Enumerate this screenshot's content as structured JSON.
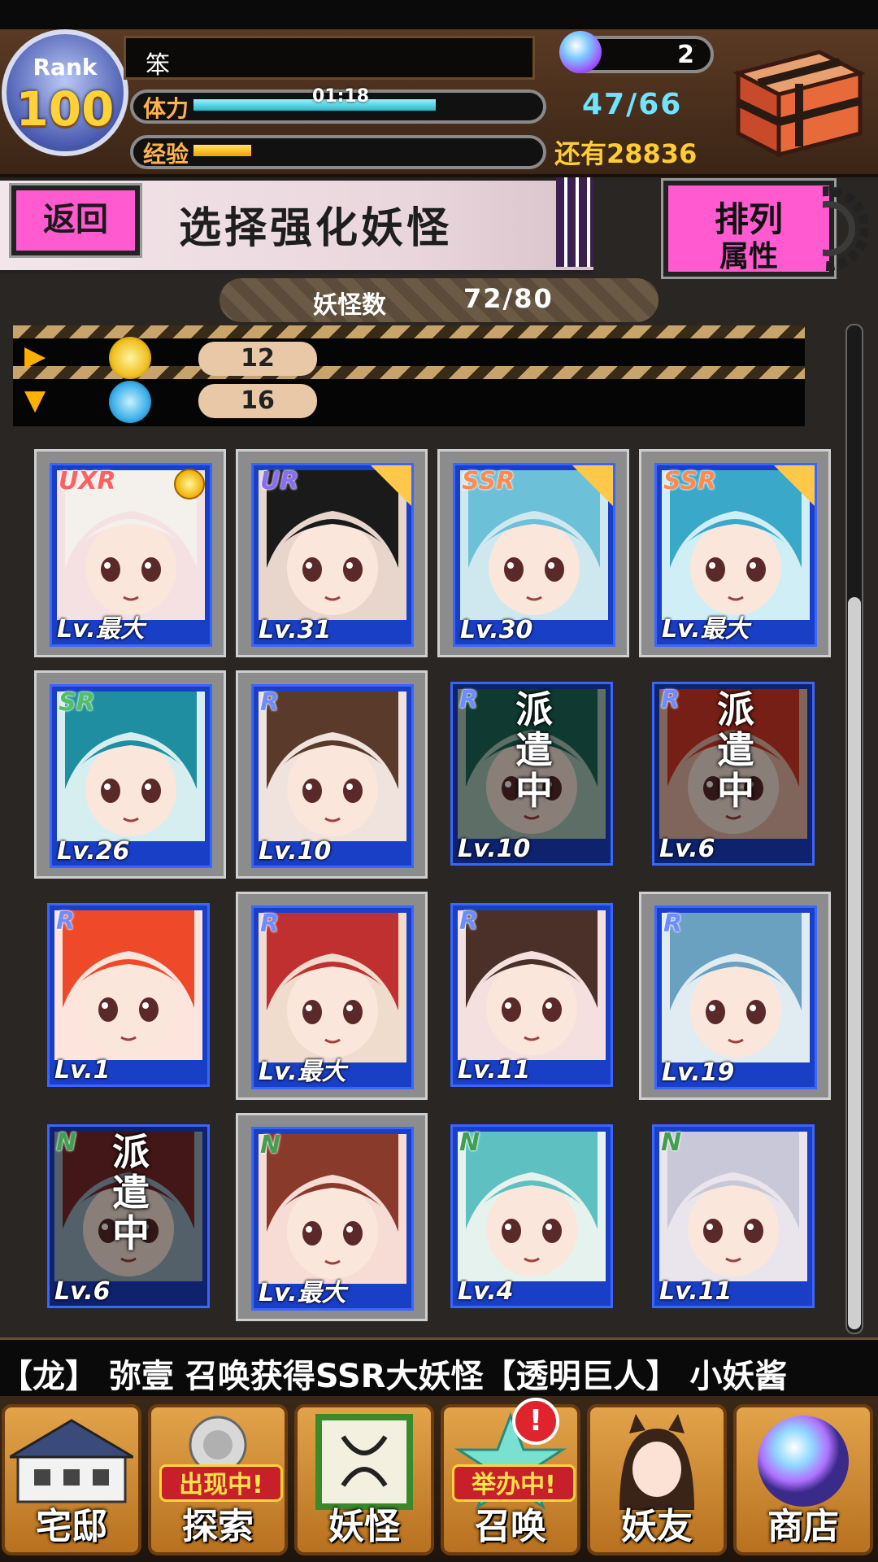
{
  "header": {
    "rank_label": "Rank",
    "rank_value": "100",
    "player_name": "笨",
    "stamina_label": "体力",
    "stamina_timer": "01:18",
    "stamina_value": "47/66",
    "stamina_fill": 0.71,
    "exp_label": "经验",
    "exp_fill": 0.17,
    "remaining_exp": "还有28836",
    "gem_count": "2"
  },
  "title_bar": {
    "back_label": "返回",
    "title": "选择强化妖怪",
    "sort_label": "排列",
    "sort_value": "属性"
  },
  "monster_count": {
    "label": "妖怪数",
    "value": "72/80"
  },
  "filters": [
    {
      "arrow": "▶",
      "icon": "gold-element-icon",
      "color": "#f0c020",
      "count": "12"
    },
    {
      "arrow": "▼",
      "icon": "water-element-icon",
      "color": "#3ab0e8",
      "count": "16"
    }
  ],
  "cards": [
    {
      "rarity": "UXR",
      "level": "Lv.最大",
      "dispatched": false,
      "selected": true,
      "bg": "#f5e1e1",
      "hair": "#f4f0ec",
      "medal": true
    },
    {
      "rarity": "UR",
      "level": "Lv.31",
      "dispatched": false,
      "selected": true,
      "bg": "#e8d6cc",
      "hair": "#1a1a1a",
      "star": true
    },
    {
      "rarity": "SSR",
      "level": "Lv.30",
      "dispatched": false,
      "selected": true,
      "bg": "#cfe8ef",
      "hair": "#6cc0d8",
      "star": true
    },
    {
      "rarity": "SSR",
      "level": "Lv.最大",
      "dispatched": false,
      "selected": true,
      "bg": "#cfeef6",
      "hair": "#3aa8c8",
      "star": true
    },
    {
      "rarity": "SR",
      "level": "Lv.26",
      "dispatched": false,
      "selected": true,
      "bg": "#d6eef0",
      "hair": "#1e8ea0"
    },
    {
      "rarity": "R",
      "level": "Lv.10",
      "dispatched": false,
      "selected": true,
      "bg": "#f0e2dc",
      "hair": "#5a3a2a"
    },
    {
      "rarity": "R",
      "level": "Lv.10",
      "dispatched": true,
      "selected": false,
      "bg": "#a8c8b8",
      "hair": "#1e6a5a"
    },
    {
      "rarity": "R",
      "level": "Lv.6",
      "dispatched": true,
      "selected": false,
      "bg": "#e8b8a8",
      "hair": "#d83a2a"
    },
    {
      "rarity": "R",
      "level": "Lv.1",
      "dispatched": false,
      "selected": false,
      "bg": "#fde4dc",
      "hair": "#ee4a2a"
    },
    {
      "rarity": "R",
      "level": "Lv.最大",
      "dispatched": false,
      "selected": true,
      "bg": "#f0dccc",
      "hair": "#c03030"
    },
    {
      "rarity": "R",
      "level": "Lv.11",
      "dispatched": false,
      "selected": false,
      "bg": "#f4e0de",
      "hair": "#4a3028"
    },
    {
      "rarity": "R",
      "level": "Lv.19",
      "dispatched": false,
      "selected": true,
      "bg": "#e0ecf2",
      "hair": "#6aa0c0"
    },
    {
      "rarity": "N",
      "level": "Lv.6",
      "dispatched": true,
      "selected": false,
      "bg": "#9ab0c0",
      "hair": "#7a2a2a"
    },
    {
      "rarity": "N",
      "level": "Lv.最大",
      "dispatched": false,
      "selected": true,
      "bg": "#f6dcd4",
      "hair": "#8a3a2a"
    },
    {
      "rarity": "N",
      "level": "Lv.4",
      "dispatched": false,
      "selected": false,
      "bg": "#e6f2ee",
      "hair": "#5ec0c0"
    },
    {
      "rarity": "N",
      "level": "Lv.11",
      "dispatched": false,
      "selected": false,
      "bg": "#eae4ec",
      "hair": "#c8c8d8"
    }
  ],
  "dispatch_label": [
    "派",
    "遣",
    "中"
  ],
  "ticker": "【龙】   弥壹 召唤获得SSR大妖怪【透明巨人】   小妖酱",
  "nav": [
    {
      "label": "宅邸",
      "icon": "mansion-icon",
      "banner": ""
    },
    {
      "label": "探索",
      "icon": "explore-icon",
      "banner": "出现中!"
    },
    {
      "label": "妖怪",
      "icon": "monster-scroll-icon",
      "banner": ""
    },
    {
      "label": "召唤",
      "icon": "summon-star-icon",
      "banner": "举办中!"
    },
    {
      "label": "妖友",
      "icon": "friend-girl-icon",
      "banner": ""
    },
    {
      "label": "商店",
      "icon": "shop-orb-icon",
      "banner": ""
    }
  ],
  "summon_alert": "!",
  "colors": {
    "accent_pink": "#ff5ad0",
    "card_blue": "#1a3fc7",
    "gold": "#ffcc33",
    "cyan": "#6fe3ff"
  }
}
